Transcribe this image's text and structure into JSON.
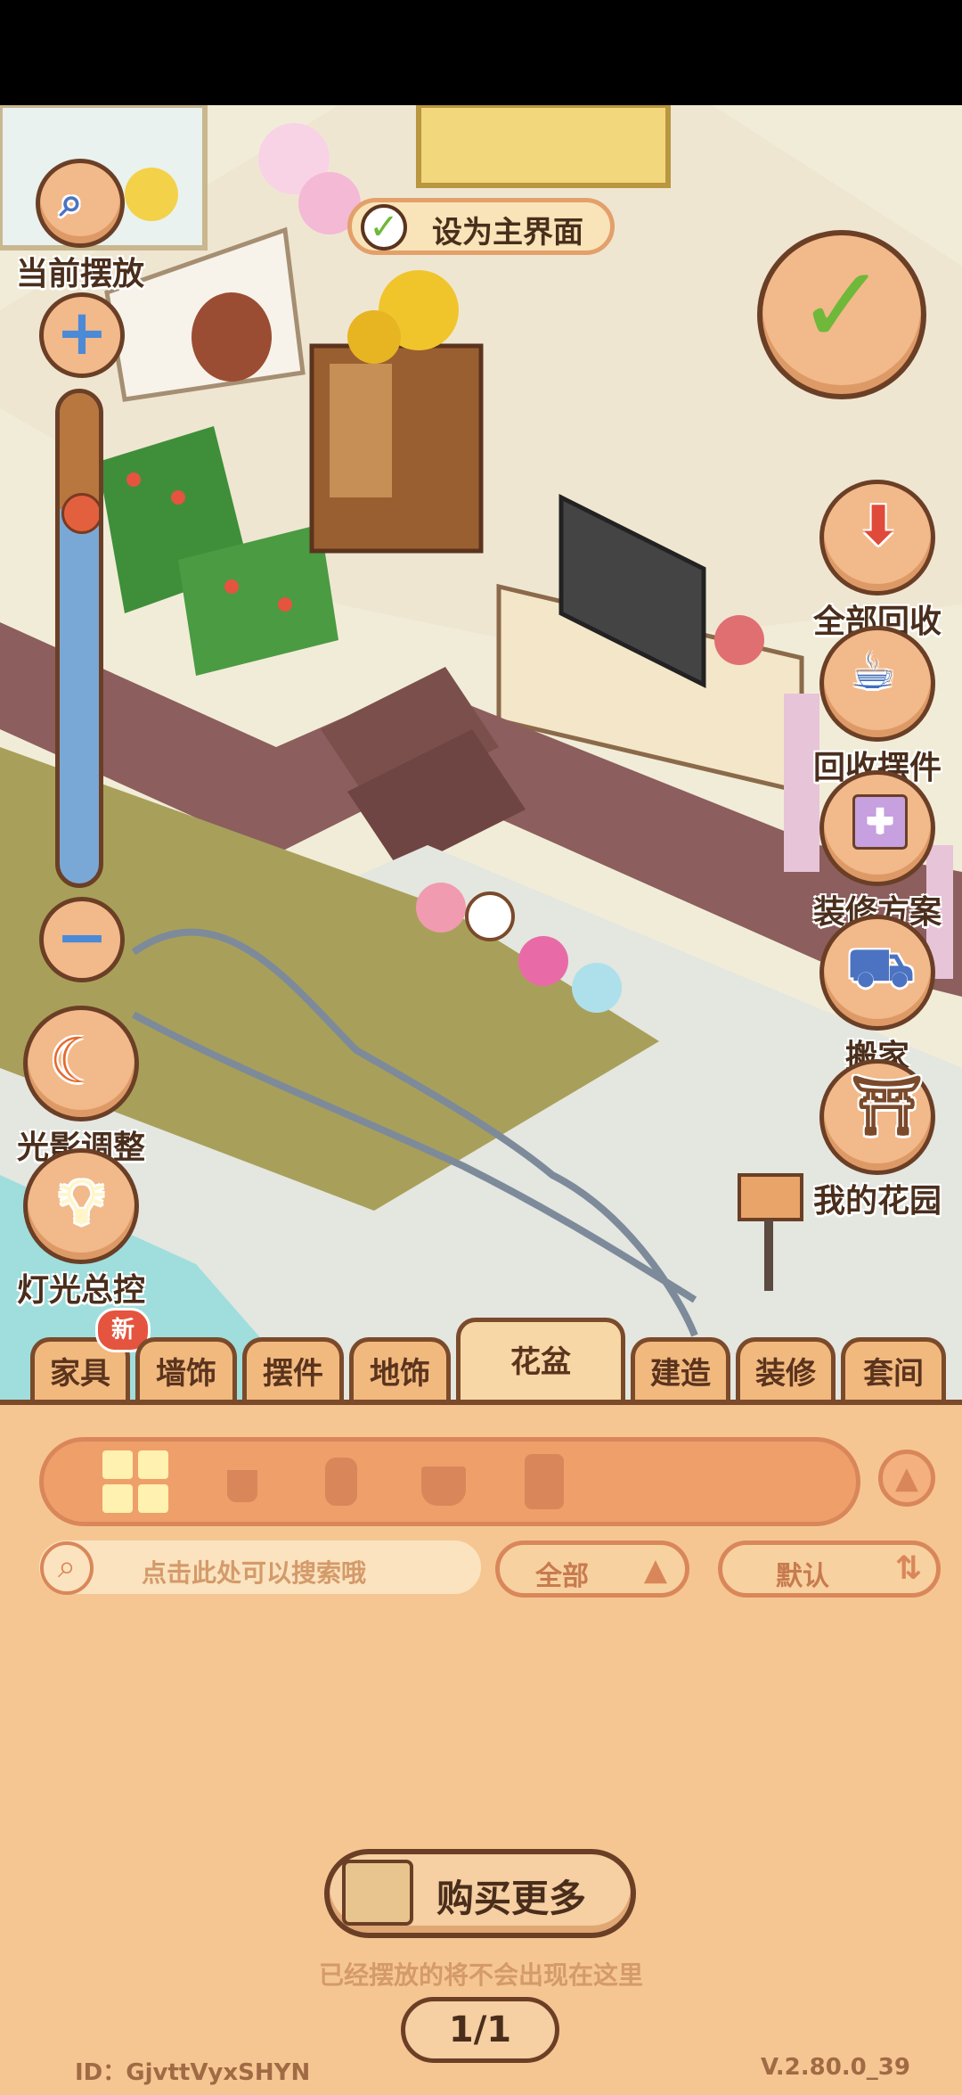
{
  "top_banner": {
    "label": "设为主界面"
  },
  "left_buttons": {
    "current_place": "当前摆放",
    "light_shadow": "光影调整",
    "lights_control": "灯光总控"
  },
  "right_buttons": {
    "recycle_all": "全部回收",
    "recycle_items": "回收摆件",
    "design_plan": "装修方案",
    "move_house": "搬家",
    "my_garden": "我的花园"
  },
  "tabs": [
    {
      "label": "家具",
      "badge": "新"
    },
    {
      "label": "墙饰"
    },
    {
      "label": "摆件"
    },
    {
      "label": "地饰"
    },
    {
      "label": "花盆",
      "active": true
    },
    {
      "label": "建造"
    },
    {
      "label": "装修"
    },
    {
      "label": "套间"
    }
  ],
  "search": {
    "placeholder": "点击此处可以搜索哦"
  },
  "filter": {
    "category": "全部",
    "sort": "默认"
  },
  "buy_more": "购买更多",
  "hint": "已经摆放的将不会出现在这里",
  "page_indicator": "1/1",
  "footer": {
    "id": "ID：GjvttVyxSHYN",
    "version": "V.2.80.0_39"
  },
  "colors": {
    "panel": "#f6c692",
    "border": "#7a4a2a",
    "accent_green": "#6fb83a"
  }
}
